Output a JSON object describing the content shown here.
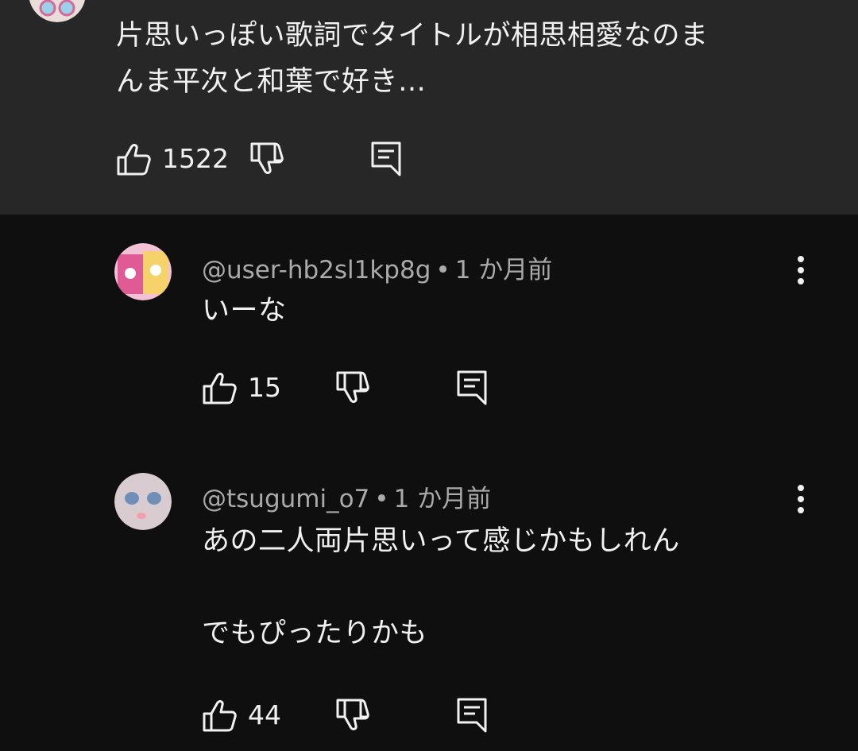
{
  "parent": {
    "text_line1": "片思いっぽい歌詞でタイトルが相思相愛なのま",
    "text_line2": "んま平次と和葉で好き…",
    "like_count": "1522"
  },
  "replies": [
    {
      "username": "@user-hb2sl1kp8g",
      "time": "1 か月前",
      "text": "いーな",
      "like_count": "15"
    },
    {
      "username": "@tsugumi_o7",
      "time": "1 か月前",
      "text_line1": "あの二人両片思いって感じかもしれん",
      "text_line2": "でもぴったりかも",
      "like_count": "44"
    }
  ],
  "separator": "•",
  "colors": {
    "background": "#0f0f0f",
    "highlight_background": "#272727",
    "text_primary": "#f1f1f1",
    "text_secondary": "#aaaaaa"
  },
  "icons": [
    "like-icon",
    "dislike-icon",
    "reply-icon",
    "more-options-icon"
  ]
}
